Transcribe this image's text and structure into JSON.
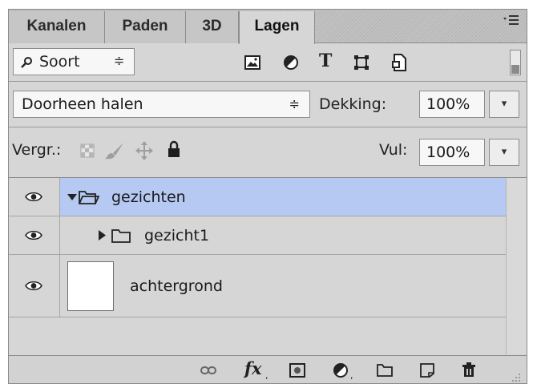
{
  "tabs": [
    {
      "label": "Kanalen",
      "active": false
    },
    {
      "label": "Paden",
      "active": false
    },
    {
      "label": "3D",
      "active": false
    },
    {
      "label": "Lagen",
      "active": true
    }
  ],
  "filter": {
    "search_icon": "search-icon",
    "kind_label": "Soort",
    "filter_icons": [
      "image-filter-icon",
      "adjustment-filter-icon",
      "type-filter-icon",
      "shape-filter-icon",
      "smart-object-filter-icon"
    ],
    "type_glyph": "T"
  },
  "blend": {
    "mode": "Doorheen halen",
    "opacity_label": "Dekking:",
    "opacity_value": "100%"
  },
  "lock": {
    "label": "Vergr.:",
    "fill_label": "Vul:",
    "fill_value": "100%",
    "icons": [
      "lock-transparency-icon",
      "lock-paint-icon",
      "lock-position-icon",
      "lock-all-icon"
    ]
  },
  "layers": [
    {
      "name": "gezichten",
      "type": "group",
      "expanded": true,
      "selected": true,
      "visible": true
    },
    {
      "name": "gezicht1",
      "type": "group",
      "expanded": false,
      "selected": false,
      "visible": true
    },
    {
      "name": "achtergrond",
      "type": "pixel",
      "selected": false,
      "visible": true
    }
  ],
  "bottom_icons": [
    "link-layers-icon",
    "fx-icon",
    "add-mask-icon",
    "adjustment-layer-icon",
    "new-group-icon",
    "new-layer-icon",
    "delete-layer-icon"
  ],
  "fx_label": "fx",
  "colors": {
    "selection": "#b6c9f3",
    "panel": "#d6d6d6"
  }
}
